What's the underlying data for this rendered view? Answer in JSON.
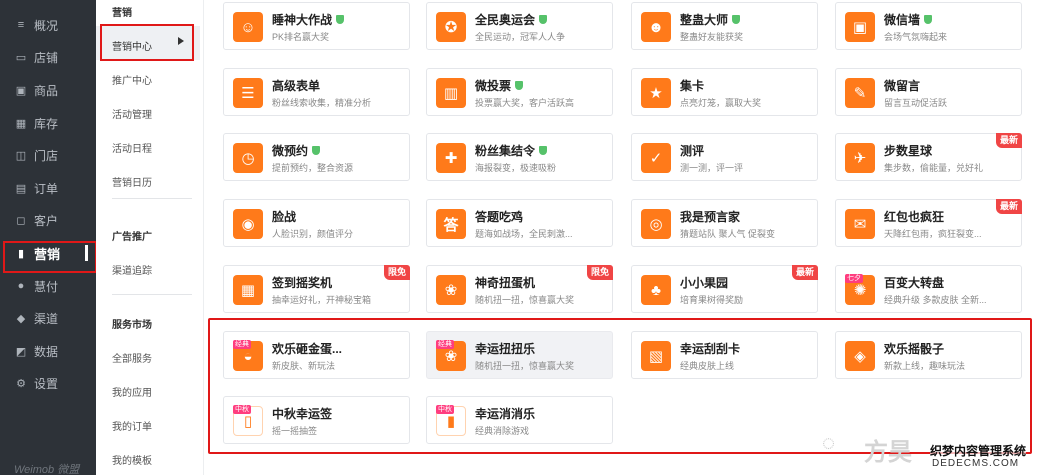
{
  "nav": {
    "items": [
      {
        "icon": "overview-icon",
        "glyph": "≡",
        "label": "概况"
      },
      {
        "icon": "shop-icon",
        "glyph": "▭",
        "label": "店铺"
      },
      {
        "icon": "goods-icon",
        "glyph": "▣",
        "label": "商品"
      },
      {
        "icon": "stock-icon",
        "glyph": "▦",
        "label": "库存"
      },
      {
        "icon": "store-icon",
        "glyph": "◫",
        "label": "门店"
      },
      {
        "icon": "order-icon",
        "glyph": "▤",
        "label": "订单"
      },
      {
        "icon": "customer-icon",
        "glyph": "◻",
        "label": "客户"
      },
      {
        "icon": "marketing-icon",
        "glyph": "▮",
        "label": "营销"
      },
      {
        "icon": "pay-icon",
        "glyph": "●",
        "label": "慧付"
      },
      {
        "icon": "channel-icon",
        "glyph": "◆",
        "label": "渠道"
      },
      {
        "icon": "data-icon",
        "glyph": "◩",
        "label": "数据"
      },
      {
        "icon": "settings-icon",
        "glyph": "⚙",
        "label": "设置"
      }
    ],
    "logo": "Weimob 微盟"
  },
  "sub": {
    "section1_title": "营销",
    "section1_items": [
      "营销中心",
      "推广中心",
      "活动管理",
      "活动日程",
      "营销日历"
    ],
    "section2_title": "广告推广",
    "section2_items": [
      "渠道追踪"
    ],
    "section3_title": "服务市场",
    "section3_items": [
      "全部服务",
      "我的应用",
      "我的订单",
      "我的模板"
    ]
  },
  "cards": [
    {
      "title": "睡神大作战",
      "desc": "PK排名赢大奖",
      "glyph": "☺",
      "verified": true,
      "badge": ""
    },
    {
      "title": "全民奥运会",
      "desc": "全民运动，冠军人人争",
      "glyph": "✪",
      "verified": true,
      "badge": ""
    },
    {
      "title": "整蛊大师",
      "desc": "整蛊好友能获奖",
      "glyph": "☻",
      "verified": true,
      "badge": ""
    },
    {
      "title": "微信墙",
      "desc": "会场气氛嗨起来",
      "glyph": "▣",
      "verified": true,
      "badge": ""
    },
    {
      "title": "高级表单",
      "desc": "粉丝线索收集，精准分析",
      "glyph": "☰",
      "verified": false,
      "badge": ""
    },
    {
      "title": "微投票",
      "desc": "投票赢大奖，客户活跃高",
      "glyph": "▥",
      "verified": true,
      "badge": ""
    },
    {
      "title": "集卡",
      "desc": "点亮灯笼，赢取大奖",
      "glyph": "★",
      "verified": false,
      "badge": ""
    },
    {
      "title": "微留言",
      "desc": "留言互动促活跃",
      "glyph": "✎",
      "verified": false,
      "badge": ""
    },
    {
      "title": "微预约",
      "desc": "提前预约，整合资源",
      "glyph": "◷",
      "verified": true,
      "badge": ""
    },
    {
      "title": "粉丝集结令",
      "desc": "海报裂变，极速吸粉",
      "glyph": "✚",
      "verified": true,
      "badge": ""
    },
    {
      "title": "测评",
      "desc": "测一测，评一评",
      "glyph": "✓",
      "verified": false,
      "badge": ""
    },
    {
      "title": "步数星球",
      "desc": "集步数，偷能量，兑好礼",
      "glyph": "✈",
      "verified": false,
      "badge": "最新"
    },
    {
      "title": "脸战",
      "desc": "人脸识别，颜值评分",
      "glyph": "◉",
      "verified": false,
      "badge": ""
    },
    {
      "title": "答题吃鸡",
      "desc": "题海如战场，全民刺激...",
      "glyph": "答",
      "verified": false,
      "badge": ""
    },
    {
      "title": "我是预言家",
      "desc": "猜题站队 聚人气 促裂变",
      "glyph": "◎",
      "verified": false,
      "badge": ""
    },
    {
      "title": "红包也疯狂",
      "desc": "天降红包雨，疯狂裂变...",
      "glyph": "✉",
      "verified": false,
      "badge": "最新"
    },
    {
      "title": "签到摇奖机",
      "desc": "抽幸运好礼，开神秘宝箱",
      "glyph": "▦",
      "verified": false,
      "badge": "限免"
    },
    {
      "title": "神奇扭蛋机",
      "desc": "随机扭一扭，惊喜赢大奖",
      "glyph": "❀",
      "verified": false,
      "badge": "限免"
    },
    {
      "title": "小小果园",
      "desc": "培育果树得奖励",
      "glyph": "♣",
      "verified": false,
      "badge": "最新"
    },
    {
      "title": "百变大转盘",
      "desc": "经典升级 多款皮肤 全新...",
      "glyph": "✺",
      "verified": false,
      "badge": "",
      "tag": "七夕"
    },
    {
      "title": "欢乐砸金蛋...",
      "desc": "新皮肤、新玩法",
      "glyph": "◒",
      "verified": false,
      "badge": "",
      "tag": "经典"
    },
    {
      "title": "幸运扭扭乐",
      "desc": "随机扭一扭，惊喜赢大奖",
      "glyph": "❀",
      "verified": false,
      "badge": "",
      "tag": "经典"
    },
    {
      "title": "幸运刮刮卡",
      "desc": "经典皮肤上线",
      "glyph": "▧",
      "verified": false,
      "badge": ""
    },
    {
      "title": "欢乐摇骰子",
      "desc": "新款上线，趣味玩法",
      "glyph": "◈",
      "verified": false,
      "badge": ""
    },
    {
      "title": "中秋幸运签",
      "desc": "摇一摇抽签",
      "glyph": "▯",
      "verified": false,
      "badge": "",
      "tag": "中秋"
    },
    {
      "title": "幸运消消乐",
      "desc": "经典消除游戏",
      "glyph": "▮",
      "verified": false,
      "badge": "",
      "tag": "中秋"
    }
  ],
  "watermark": {
    "brand": "方昊",
    "site_cn": "织梦内容管理系统",
    "site_en": "DEDECMS.COM"
  },
  "colors": {
    "nav_bg": "#2d3238",
    "accent": "#ff7a1a",
    "highlight": "#e01818",
    "badge": "#f04545",
    "verified": "#56c26a"
  }
}
